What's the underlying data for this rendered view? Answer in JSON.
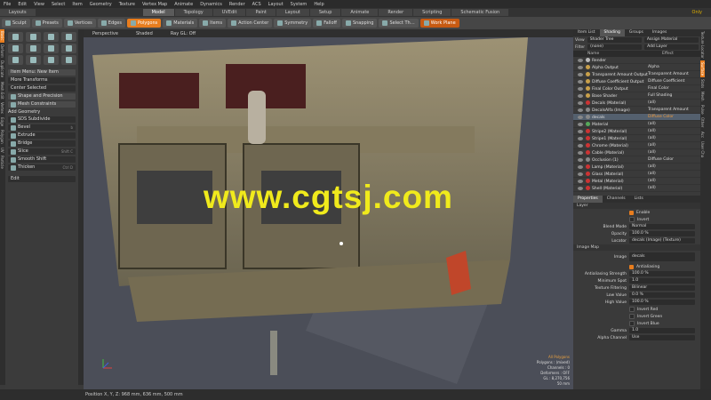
{
  "menubar": {
    "items": [
      "File",
      "Edit",
      "View",
      "Select",
      "Item",
      "Geometry",
      "Texture",
      "Vertex Map",
      "Animate",
      "Dynamics",
      "Render",
      "ACS",
      "Layout",
      "System",
      "Help"
    ]
  },
  "layoutbar": {
    "layouts_label": "Layouts",
    "tabs": [
      "Model",
      "Topology",
      "UVEdit",
      "Paint",
      "Layout",
      "Setup",
      "Animate",
      "Render",
      "Scripting",
      "Schematic Fusion"
    ],
    "active_tab": "Model",
    "only_label": "Only"
  },
  "toolbar": {
    "items": [
      "Sculpt",
      "Presets",
      "Vertices",
      "Edges",
      "Polygons",
      "Materials",
      "Items",
      "Action Center",
      "Symmetry",
      "Falloff",
      "Snapping",
      "Select Th…",
      "Work Plane"
    ]
  },
  "left_vtabs": [
    "Basic",
    "Deform",
    "Duplicate",
    "Mesh Edit",
    "Vertex",
    "Edge",
    "Polygon",
    "UV",
    "Particle"
  ],
  "left_panel": {
    "item_menu": "Item Menu: New Item",
    "more_transforms": "More Transforms",
    "center_selected": "Center Selected",
    "shape": "Shape and Precision",
    "mesh_constraints": "Mesh Constraints",
    "add_geometry": "Add Geometry",
    "tools": [
      {
        "label": "SDS Subdivide",
        "key": ""
      },
      {
        "label": "Bevel",
        "key": "b"
      },
      {
        "label": "Extrude",
        "key": ""
      },
      {
        "label": "Bridge",
        "key": ""
      },
      {
        "label": "Slice",
        "key": "Shift C"
      },
      {
        "label": "Smooth Shift",
        "key": ""
      },
      {
        "label": "Thicken",
        "key": "Ctrl D"
      }
    ],
    "edit": "Edit"
  },
  "viewport": {
    "header": [
      "Perspective",
      "Shaded",
      "Ray GL: Off"
    ],
    "watermark": "www.cgtsj.com",
    "info": [
      "All Polygons",
      "Polygons : (mixed)",
      "Channels : 0",
      "Deformers : OFF",
      "GL : 8,270,756",
      "50 mm"
    ]
  },
  "shader_panel": {
    "top_tabs": [
      "Item List",
      "Shading",
      "Groups",
      "Images"
    ],
    "view_label": "View",
    "view_value": "Shader Tree",
    "assign_material": "Assign Material",
    "filter_label": "Filter",
    "filter_value": "(none)",
    "add_layer": "Add Layer",
    "col_name": "Name",
    "col_effect": "Effect",
    "rows": [
      {
        "name": "Render",
        "effect": "",
        "color": "#bbbbbb",
        "sel": false
      },
      {
        "name": "Alpha Output",
        "effect": "Alpha",
        "color": "#c9a04a",
        "sel": false
      },
      {
        "name": "Transparent Amount Output",
        "effect": "Transparent Amount",
        "color": "#c9a04a",
        "sel": false
      },
      {
        "name": "Diffuse Coefficient Output",
        "effect": "Diffuse Coefficient",
        "color": "#c9a04a",
        "sel": false
      },
      {
        "name": "Final Color Output",
        "effect": "Final Color",
        "color": "#c9a04a",
        "sel": false
      },
      {
        "name": "Base Shader",
        "effect": "Full Shading",
        "color": "#c9a04a",
        "sel": false
      },
      {
        "name": "Decals (Material)",
        "effect": "(all)",
        "color": "#cc3333",
        "sel": false
      },
      {
        "name": "DecalsAlfa (Image)",
        "effect": "Transparent Amount",
        "color": "#888888",
        "sel": false
      },
      {
        "name": "decals",
        "effect": "Diffuse Color",
        "color": "#888888",
        "sel": true
      },
      {
        "name": "Material",
        "effect": "(all)",
        "color": "#56a85a",
        "sel": false
      },
      {
        "name": "Stripe2 (Material)",
        "effect": "(all)",
        "color": "#cc3333",
        "sel": false
      },
      {
        "name": "Stripe1 (Material)",
        "effect": "(all)",
        "color": "#cc3333",
        "sel": false
      },
      {
        "name": "Chrome (Material)",
        "effect": "(all)",
        "color": "#cc3333",
        "sel": false
      },
      {
        "name": "Cable (Material)",
        "effect": "(all)",
        "color": "#cc3333",
        "sel": false
      },
      {
        "name": "Occlusion (1)",
        "effect": "Diffuse Color",
        "color": "#888888",
        "sel": false
      },
      {
        "name": "Lamp (Material)",
        "effect": "(all)",
        "color": "#cc3333",
        "sel": false
      },
      {
        "name": "Glass (Material)",
        "effect": "(all)",
        "color": "#cc3333",
        "sel": false
      },
      {
        "name": "Metal (Material)",
        "effect": "(all)",
        "color": "#cc3333",
        "sel": false
      },
      {
        "name": "Shell (Material)",
        "effect": "(all)",
        "color": "#cc3333",
        "sel": false
      }
    ]
  },
  "properties": {
    "tabs": [
      "Properties",
      "Channels",
      "Lists"
    ],
    "layer_section": "Layer",
    "enable": "Enable",
    "invert": "Invert",
    "blend_mode_label": "Blend Mode",
    "blend_mode_value": "Normal",
    "opacity_label": "Opacity",
    "opacity_value": "100.0 %",
    "locator_label": "Locator",
    "locator_value": "decals (Image) (Texture)",
    "image_map_section": "Image Map",
    "image_label": "Image",
    "image_value": "decals",
    "antialiasing": "Antialiasing",
    "aa_strength_label": "Antialiasing Strength",
    "aa_strength_value": "100.0 %",
    "min_spot_label": "Minimum Spot",
    "min_spot_value": "1.0",
    "tex_filter_label": "Texture Filtering",
    "tex_filter_value": "Bilinear",
    "low_value_label": "Low Value",
    "low_value_value": "0.0 %",
    "high_value_label": "High Value",
    "high_value_value": "100.0 %",
    "invert_red": "Invert Red",
    "invert_green": "Invert Green",
    "invert_blue": "Invert Blue",
    "gamma_label": "Gamma",
    "gamma_value": "1.0",
    "alpha_channel_label": "Alpha Channel",
    "alpha_channel_value": "Use"
  },
  "right_vtabs": [
    "Texture Locator",
    "Surface",
    "Stats",
    "Mesh",
    "Pulse",
    "Other",
    "Acc",
    "User Cha"
  ],
  "statusbar": {
    "position": "Position X, Y, Z:   968 mm, 636 mm, 500 mm"
  },
  "colors": {
    "accent": "#e87d1e",
    "watermark": "#f0ea1c"
  }
}
